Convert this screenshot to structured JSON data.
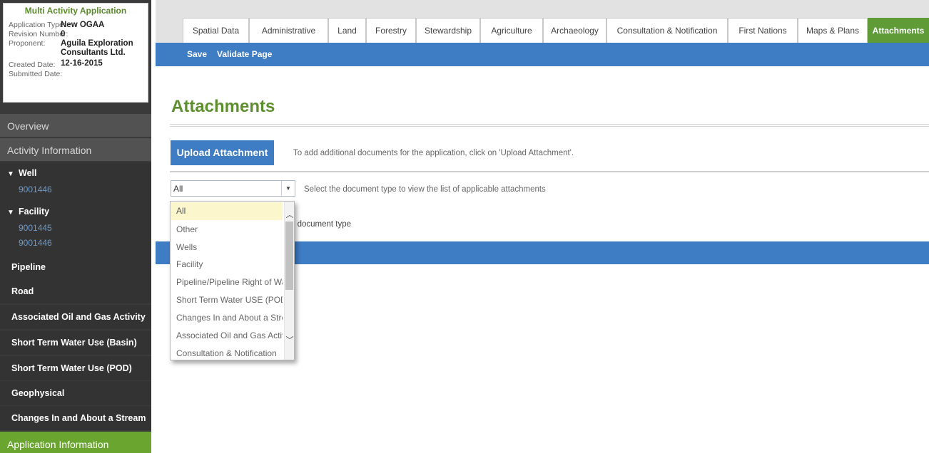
{
  "app_card": {
    "title": "Multi Activity Application",
    "rows": [
      {
        "label": "Application Type:",
        "value": "New OGAA"
      },
      {
        "label": "Revision Number:",
        "value": "0"
      },
      {
        "label": "Proponent:",
        "value": "Aguila Exploration"
      },
      {
        "label": "",
        "value": "Consultants Ltd."
      },
      {
        "label": "Created Date:",
        "value": "12-16-2015"
      },
      {
        "label": "Submitted Date:",
        "value": ""
      }
    ]
  },
  "sidebar": {
    "overview": "Overview",
    "activity_info": "Activity Information",
    "well": {
      "label": "Well",
      "links": [
        "9001446"
      ]
    },
    "facility": {
      "label": "Facility",
      "links": [
        "9001445",
        "9001446"
      ]
    },
    "items": [
      "Pipeline",
      "Road",
      "Associated Oil and Gas Activity",
      "Short Term Water Use (Basin)",
      "Short Term Water Use (POD)",
      "Geophysical",
      "Changes In and About a Stream"
    ],
    "application_info": "Application Information"
  },
  "tabs": [
    "Spatial Data",
    "Administrative",
    "Land",
    "Forestry",
    "Stewardship",
    "Agriculture",
    "Archaeology",
    "Consultation & Notification",
    "First Nations",
    "Maps & Plans",
    "Attachments"
  ],
  "active_tab": "Attachments",
  "toolbar": {
    "save": "Save",
    "validate": "Validate Page"
  },
  "page": {
    "title": "Attachments",
    "upload_button": "Upload Attachment",
    "upload_help": "To add additional documents for the application, click on 'Upload Attachment'.",
    "select_value": "All",
    "select_help": "Select the document type to view the list of applicable attachments",
    "partial_text": "d document type"
  },
  "dropdown": {
    "options": [
      "All",
      "Other",
      "Wells",
      "Facility",
      "Pipeline/Pipeline Right of Way)",
      "Short Term Water USE (POD)",
      "Changes In and About a Stream",
      "Associated Oil and Gas Activity",
      "Consultation & Notification"
    ],
    "selected_index": 0
  },
  "colors": {
    "green": "#5f9c37",
    "blue": "#3e7cc4",
    "sidebar": "#333333"
  }
}
